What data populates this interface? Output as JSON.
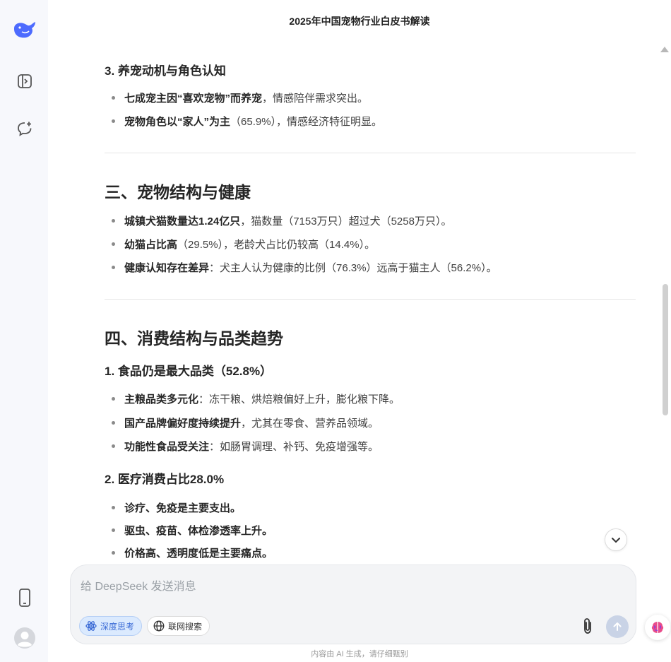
{
  "header": {
    "title": "2025年中国宠物行业白皮书解读"
  },
  "sidebar": {
    "icons": [
      "deepseek-logo",
      "toggle-sidebar-icon",
      "new-chat-icon",
      "mobile-app-icon",
      "user-avatar"
    ]
  },
  "sections": {
    "s3_motive": {
      "heading": "3. 养宠动机与角色认知",
      "items": [
        {
          "bold": "七成宠主因“喜欢宠物”而养宠",
          "rest": "，情感陪伴需求突出。"
        },
        {
          "bold": "宠物角色以“家人”为主",
          "rest": "（65.9%），情感经济特征明显。"
        }
      ]
    },
    "part3": {
      "heading": "三、宠物结构与健康",
      "items": [
        {
          "bold": "城镇犬猫数量达1.24亿只",
          "rest": "，猫数量（7153万只）超过犬（5258万只）。"
        },
        {
          "bold": "幼猫占比高",
          "rest": "（29.5%），老龄犬占比仍较高（14.4%）。"
        },
        {
          "bold": "健康认知存在差异",
          "rest": "：犬主人认为健康的比例（76.3%）远高于猫主人（56.2%）。"
        }
      ]
    },
    "part4": {
      "heading": "四、消费结构与品类趋势",
      "sub1": {
        "heading": "1. 食品仍是最大品类（52.8%）",
        "items": [
          {
            "bold": "主粮品类多元化",
            "rest": "：冻干粮、烘焙粮偏好上升，膨化粮下降。"
          },
          {
            "bold": "国产品牌偏好度持续提升",
            "rest": "，尤其在零食、营养品领域。"
          },
          {
            "bold": "功能性食品受关注",
            "rest": "：如肠胃调理、补钙、免疫增强等。"
          }
        ]
      },
      "sub2": {
        "heading": "2. 医疗消费占比28.0%",
        "items": [
          {
            "bold": "诊疗、免疫是主要支出。",
            "rest": ""
          },
          {
            "bold": "驱虫、疫苗、体检渗透率上升。",
            "rest": ""
          },
          {
            "bold": "价格高、透明度低是主要痛点。",
            "rest": ""
          }
        ]
      }
    }
  },
  "composer": {
    "placeholder": "给 DeepSeek 发送消息",
    "deep_think_label": "深度思考",
    "web_search_label": "联网搜索"
  },
  "footer": {
    "note": "内容由 AI 生成，请仔细甄别"
  },
  "colors": {
    "accent": "#4d6bfe",
    "pill_active_bg": "#dbeafe"
  }
}
